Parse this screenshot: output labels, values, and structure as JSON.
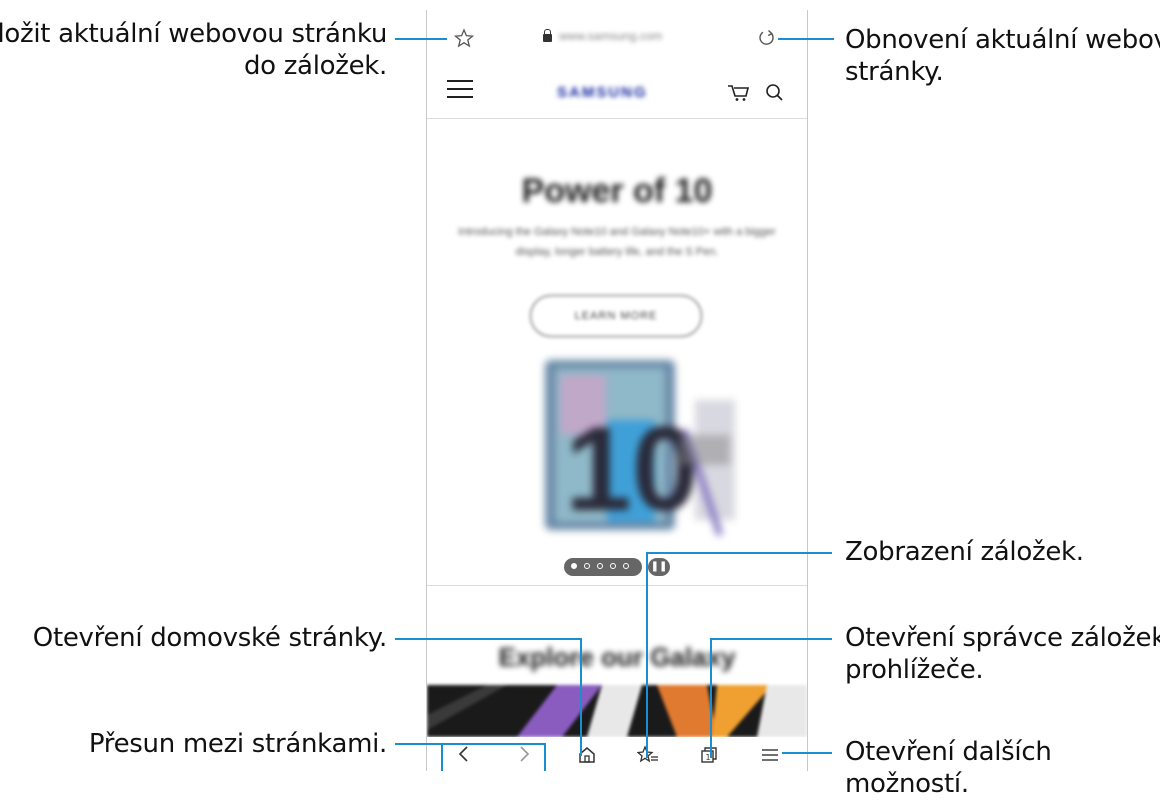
{
  "browser": {
    "url": "www.samsung.com",
    "brand": "SAMSUNG",
    "hero_title": "Power of 10",
    "hero_text": "Introducing the Galaxy Note10 and Galaxy Note10+ with a bigger display, longer battery life, and the S Pen.",
    "learn_more_label": "LEARN MORE",
    "explore_title": "Explore our Galaxy",
    "product_numeral": "10"
  },
  "callouts": {
    "bookmark_save": "Uložit aktuální webovou stránku\ndo záložek.",
    "refresh": "Obnovení aktuální webové\nstránky.",
    "view_bookmarks": "Zobrazení záložek.",
    "home": "Otevření domovské stránky.",
    "tab_manager": "Otevření správce záložek\nprohlížeče.",
    "navigate": "Přesun mezi stránkami.",
    "more_options": "Otevření dalších možností."
  },
  "icons": [
    "star-icon",
    "lock-icon",
    "refresh-icon",
    "hamburger-icon",
    "cart-icon",
    "search-icon",
    "back-icon",
    "forward-icon",
    "home-icon",
    "bookmarks-icon",
    "tabs-icon",
    "menu-icon"
  ],
  "colors": {
    "callout_line": "#1a8fd0",
    "brand": "#1428a0"
  }
}
